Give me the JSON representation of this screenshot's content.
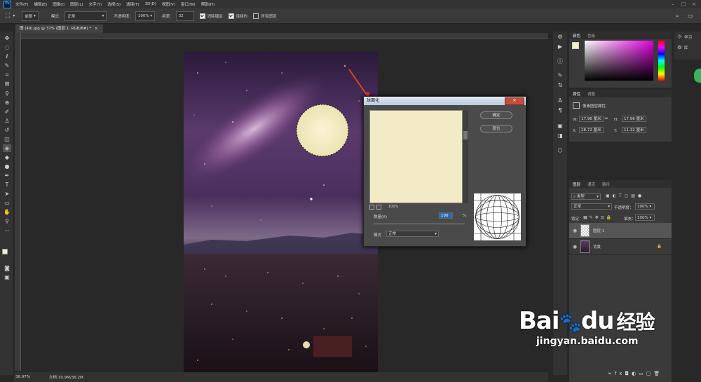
{
  "app": {
    "logo": "Ps"
  },
  "menu": [
    "文件(F)",
    "编辑(E)",
    "图像(I)",
    "图层(L)",
    "文字(Y)",
    "选择(S)",
    "滤镜(T)",
    "3D(D)",
    "视图(V)",
    "窗口(W)",
    "帮助(H)"
  ],
  "options": {
    "preset": "前景",
    "mode_label": "模式：",
    "mode_value": "正常",
    "opacity_label": "不透明度：",
    "opacity_value": "100%",
    "tolerance_label": "容差：",
    "tolerance_value": "32",
    "antialias": "消除锯齿",
    "contiguous": "连续的",
    "all_layers": "所有图层"
  },
  "document_tab": "图 (49).jpg @ 37% (图层 1, RGB/8#) *",
  "status": {
    "zoom": "36.97%",
    "doc": "文档:10.9M/36.2M"
  },
  "dialog": {
    "title": "球面化",
    "ok": "确定",
    "reset": "复位",
    "preview_zoom": "100%",
    "amount_label": "数量(A)",
    "amount_value": "100",
    "amount_unit": "%",
    "mode_label": "模式",
    "mode_value": "正常"
  },
  "color_panel": {
    "tabs": [
      "颜色",
      "色板"
    ]
  },
  "properties_panel": {
    "tabs": [
      "属性",
      "调整"
    ],
    "title": "像素图层属性",
    "w_label": "W:",
    "w_value": "17.96 厘米",
    "h_label": "H:",
    "h_value": "17.96 厘米",
    "x_label": "X:",
    "x_value": "28.72 厘米",
    "y_label": "Y:",
    "y_value": "11.32 厘米"
  },
  "layers_panel": {
    "tabs": [
      "图层",
      "通道",
      "路径"
    ],
    "filter": "类型",
    "blend": "正常",
    "opacity_label": "不透明度：",
    "opacity_value": "100%",
    "lock_label": "锁定：",
    "fill_label": "填充：",
    "fill_value": "100%",
    "layers": [
      {
        "name": "图层 1"
      },
      {
        "name": "背景"
      }
    ]
  },
  "learn": {
    "learn": "学习",
    "libraries": "库"
  },
  "watermark": {
    "brand": "Bai",
    "brand2": "du",
    "brand_cn": "经验",
    "url": "jingyan.baidu.com"
  },
  "colors": {
    "accent": "#31a8ff",
    "fg_swatch": "#f5efc8"
  }
}
